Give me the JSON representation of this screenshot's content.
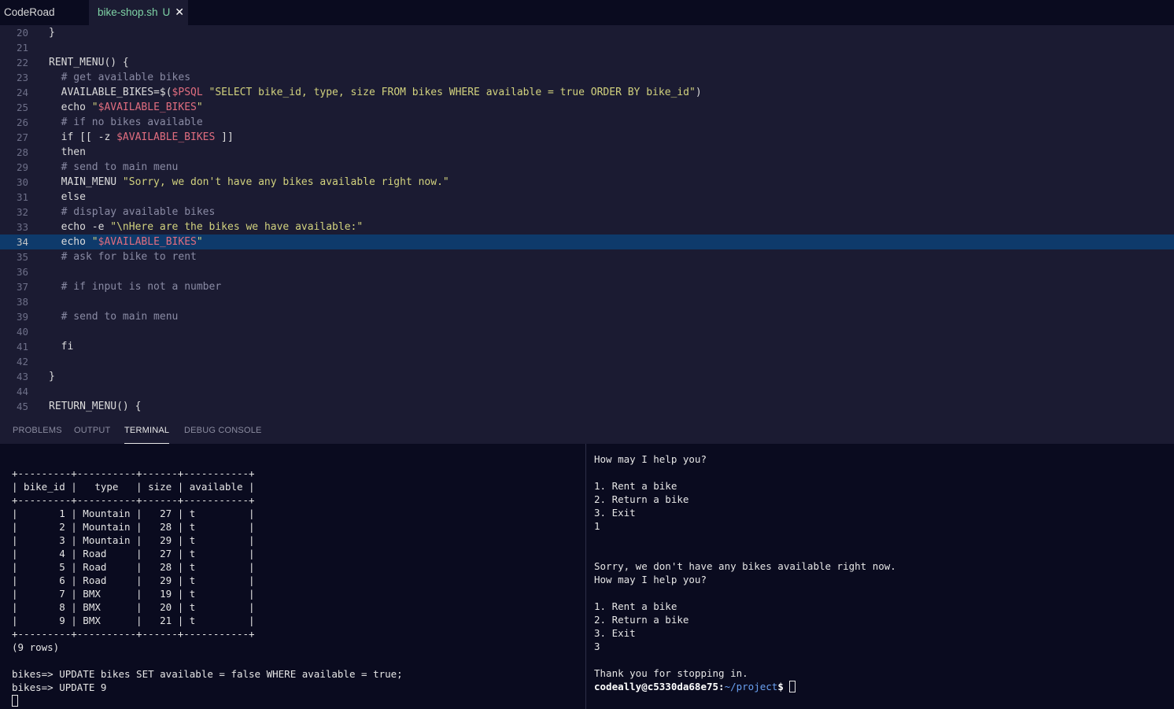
{
  "tabs": {
    "app_title": "CodeRoad",
    "file_name": "bike-shop.sh",
    "file_status": "U",
    "close_glyph": "✕"
  },
  "editor": {
    "lines": [
      {
        "n": "20",
        "text": "}"
      },
      {
        "n": "21",
        "text": ""
      },
      {
        "n": "22",
        "text": "RENT_MENU() {"
      },
      {
        "n": "23",
        "text": "  # get available bikes"
      },
      {
        "n": "24",
        "text": "  AVAILABLE_BIKES=$($PSQL \"SELECT bike_id, type, size FROM bikes WHERE available = true ORDER BY bike_id\")"
      },
      {
        "n": "25",
        "text": "  echo \"$AVAILABLE_BIKES\""
      },
      {
        "n": "26",
        "text": "  # if no bikes available"
      },
      {
        "n": "27",
        "text": "  if [[ -z $AVAILABLE_BIKES ]]"
      },
      {
        "n": "28",
        "text": "  then"
      },
      {
        "n": "29",
        "text": "  # send to main menu"
      },
      {
        "n": "30",
        "text": "  MAIN_MENU \"Sorry, we don't have any bikes available right now.\""
      },
      {
        "n": "31",
        "text": "  else"
      },
      {
        "n": "32",
        "text": "  # display available bikes"
      },
      {
        "n": "33",
        "text": "  echo -e \"\\nHere are the bikes we have available:\""
      },
      {
        "n": "34",
        "text": "  echo \"$AVAILABLE_BIKES\""
      },
      {
        "n": "35",
        "text": "  # ask for bike to rent"
      },
      {
        "n": "36",
        "text": ""
      },
      {
        "n": "37",
        "text": "  # if input is not a number"
      },
      {
        "n": "38",
        "text": ""
      },
      {
        "n": "39",
        "text": "  # send to main menu"
      },
      {
        "n": "40",
        "text": ""
      },
      {
        "n": "41",
        "text": "  fi"
      },
      {
        "n": "42",
        "text": ""
      },
      {
        "n": "43",
        "text": "}"
      },
      {
        "n": "44",
        "text": ""
      },
      {
        "n": "45",
        "text": "RETURN_MENU() {"
      }
    ],
    "active_line": "34"
  },
  "panel": {
    "tabs": [
      "PROBLEMS",
      "OUTPUT",
      "TERMINAL",
      "DEBUG CONSOLE"
    ],
    "active_tab": "TERMINAL"
  },
  "terminal_left": {
    "lines": [
      "+---------+----------+------+-----------+",
      "| bike_id |   type   | size | available |",
      "+---------+----------+------+-----------+",
      "|       1 | Mountain |   27 | t         |",
      "|       2 | Mountain |   28 | t         |",
      "|       3 | Mountain |   29 | t         |",
      "|       4 | Road     |   27 | t         |",
      "|       5 | Road     |   28 | t         |",
      "|       6 | Road     |   29 | t         |",
      "|       7 | BMX      |   19 | t         |",
      "|       8 | BMX      |   20 | t         |",
      "|       9 | BMX      |   21 | t         |",
      "+---------+----------+------+-----------+",
      "(9 rows)",
      "",
      "bikes=> UPDATE bikes SET available = false WHERE available = true;",
      "bikes=> UPDATE 9"
    ]
  },
  "terminal_right": {
    "lines": [
      "How may I help you?",
      "",
      "1. Rent a bike",
      "2. Return a bike",
      "3. Exit",
      "1",
      "",
      "",
      "Sorry, we don't have any bikes available right now.",
      "How may I help you?",
      "",
      "1. Rent a bike",
      "2. Return a bike",
      "3. Exit",
      "3",
      "",
      "Thank you for stopping in."
    ],
    "prompt_user": "codeally@c5330da68e75",
    "prompt_sep": ":",
    "prompt_path": "~/project",
    "prompt_symbol": "$ "
  }
}
